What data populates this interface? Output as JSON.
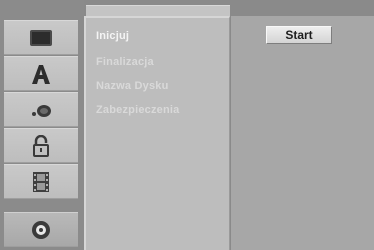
{
  "sidebar": {
    "items": [
      {
        "icon": "disc-screen-icon"
      },
      {
        "icon": "language-letter-a-icon"
      },
      {
        "icon": "audio-speaker-icon"
      },
      {
        "icon": "padlock-icon"
      },
      {
        "icon": "film-strip-icon"
      },
      {
        "icon": "disc-icon",
        "active": true
      }
    ]
  },
  "menu": {
    "items": [
      {
        "label": "Inicjuj",
        "selected": true
      },
      {
        "label": "Finalizacja"
      },
      {
        "label": "Nazwa Dysku"
      },
      {
        "label": "Zabezpieczenia"
      }
    ]
  },
  "right_panel": {
    "start_label": "Start"
  }
}
